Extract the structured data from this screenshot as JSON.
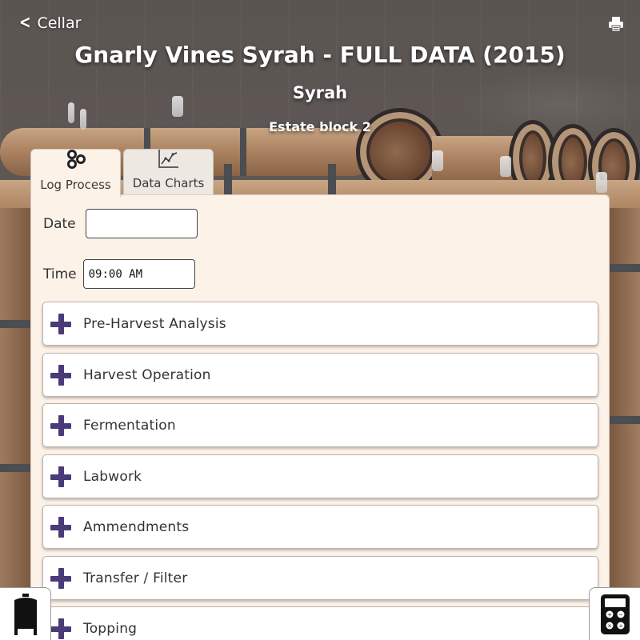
{
  "header": {
    "back_label": "Cellar",
    "title": "Gnarly Vines Syrah - FULL DATA (2015)",
    "varietal": "Syrah",
    "block": "Estate block 2"
  },
  "tabs": [
    {
      "label": "Log Process",
      "icon": "barrels-icon",
      "active": true
    },
    {
      "label": "Data Charts",
      "icon": "line-chart-icon",
      "active": false
    }
  ],
  "form": {
    "date_label": "Date",
    "date_value": "",
    "time_label": "Time",
    "time_value": "09:00 AM"
  },
  "sections": [
    {
      "label": "Pre-Harvest Analysis"
    },
    {
      "label": "Harvest Operation"
    },
    {
      "label": "Fermentation"
    },
    {
      "label": "Labwork"
    },
    {
      "label": "Ammendments"
    },
    {
      "label": "Transfer / Filter"
    },
    {
      "label": "Topping"
    }
  ],
  "colors": {
    "accent": "#4a3a78",
    "panel_bg": "#fdf2e8"
  },
  "corner_buttons": {
    "left_icon": "tank-icon",
    "right_icon": "calculator-icon"
  }
}
